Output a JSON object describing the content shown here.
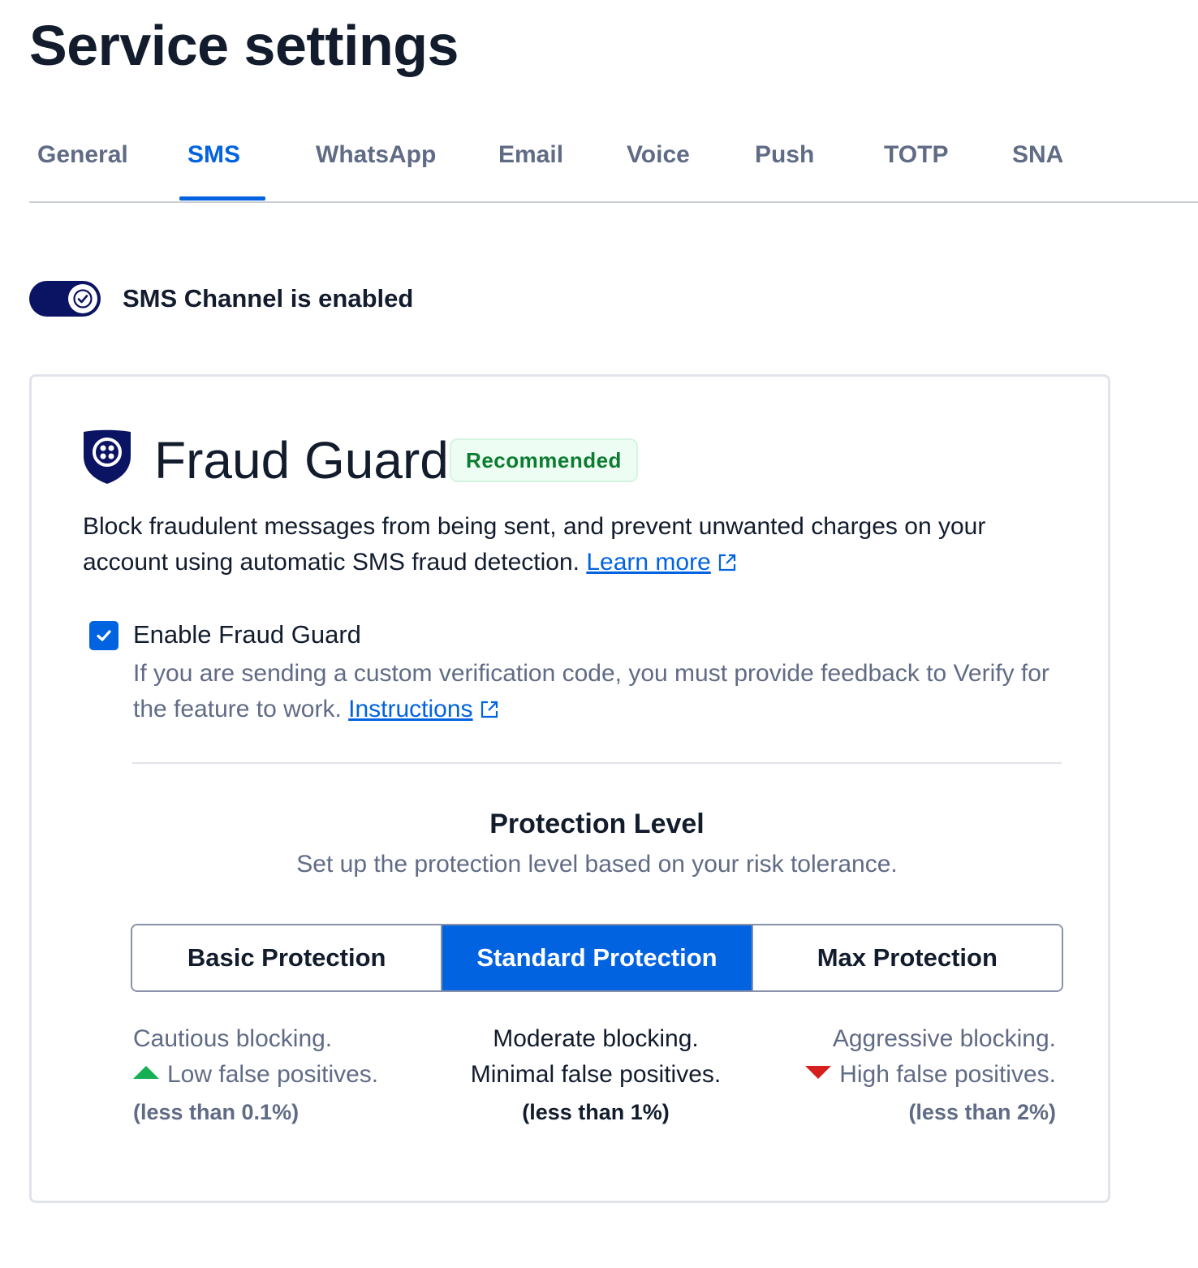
{
  "page": {
    "title": "Service settings"
  },
  "tabs": [
    {
      "label": "General"
    },
    {
      "label": "SMS"
    },
    {
      "label": "WhatsApp"
    },
    {
      "label": "Email"
    },
    {
      "label": "Voice"
    },
    {
      "label": "Push"
    },
    {
      "label": "TOTP"
    },
    {
      "label": "SNA"
    }
  ],
  "active_tab": "SMS",
  "channel": {
    "enabled": true,
    "label": "SMS Channel is enabled"
  },
  "fraud_guard": {
    "title": "Fraud Guard",
    "badge": "Recommended",
    "description": "Block fraudulent messages from being sent, and prevent unwanted charges on your account using automatic SMS fraud detection.",
    "learn_more": "Learn more",
    "enable_checked": true,
    "enable_label": "Enable Fraud Guard",
    "help_text": "If you are sending a custom verification code, you must provide feedback to Verify for the feature to work.",
    "instructions": "Instructions"
  },
  "protection": {
    "title": "Protection Level",
    "subtitle": "Set up the protection level based on your risk tolerance.",
    "options": [
      {
        "label": "Basic Protection",
        "line1": "Cautious blocking.",
        "line2": "Low false positives.",
        "pct": "(less than 0.1%)"
      },
      {
        "label": "Standard Protection",
        "line1": "Moderate blocking.",
        "line2": "Minimal false positives.",
        "pct": "(less than 1%)"
      },
      {
        "label": "Max Protection",
        "line1": "Aggressive blocking.",
        "line2": "High false positives.",
        "pct": "(less than 2%)"
      }
    ],
    "selected": "Standard Protection"
  },
  "colors": {
    "accent": "#0263e0",
    "navy": "#0b1463",
    "success": "#14b053",
    "danger": "#d61f1f"
  },
  "icons": {
    "toggle": "check-icon",
    "brand": "shield-icon",
    "external": "external-link-icon",
    "checkbox": "check-icon",
    "up": "triangle-up-icon",
    "down": "triangle-down-icon"
  }
}
